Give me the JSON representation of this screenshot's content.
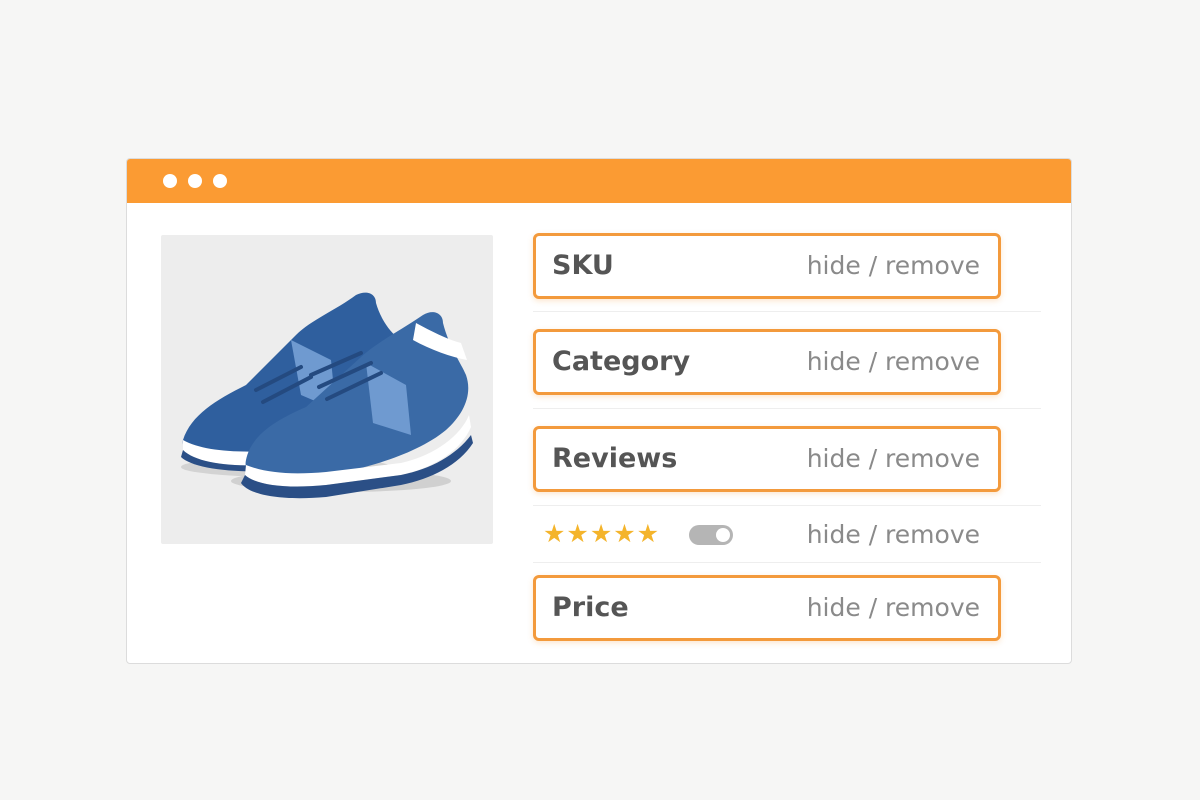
{
  "window": {
    "accent_color": "#fb9b33",
    "titlebar_dots": [
      "dot",
      "dot",
      "dot"
    ]
  },
  "product": {
    "image_icon": "sneaker-image",
    "shoe_color": "#3a6aa6"
  },
  "fields": [
    {
      "label": "SKU",
      "action": "hide / remove"
    },
    {
      "label": "Category",
      "action": "hide / remove"
    },
    {
      "label": "Reviews",
      "action": "hide / remove"
    }
  ],
  "rating": {
    "stars": "★★★★★",
    "star_count": 5,
    "toggle_on": true,
    "action": "hide / remove"
  },
  "price_field": {
    "label": "Price",
    "action": "hide / remove"
  },
  "colors": {
    "field_border": "#f39a3c",
    "star": "#f4b42b",
    "toggle": "#b5b5b5"
  }
}
